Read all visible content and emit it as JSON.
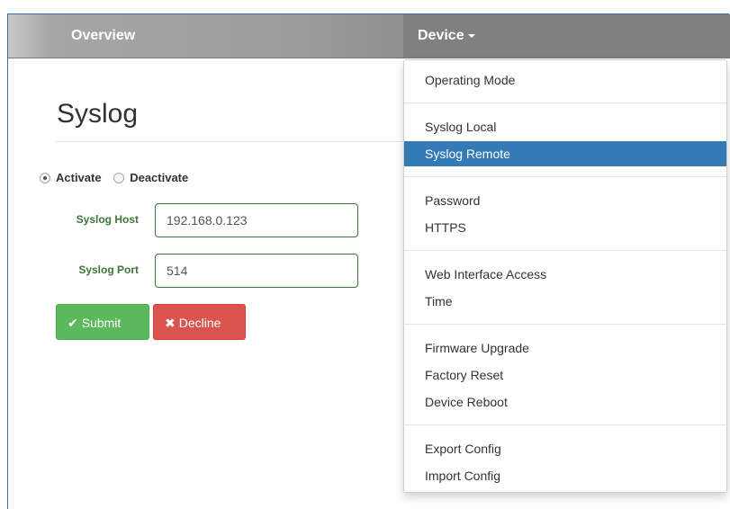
{
  "navbar": {
    "overview_label": "Overview",
    "device_label": "Device"
  },
  "page": {
    "title": "Syslog"
  },
  "status": {
    "activate_label": "Activate",
    "deactivate_label": "Deactivate",
    "selected": "Activate"
  },
  "form": {
    "host_label": "Syslog Host",
    "host_value": "192.168.0.123",
    "port_label": "Syslog Port",
    "port_value": "514"
  },
  "buttons": {
    "submit_label": "Submit",
    "decline_label": "Decline"
  },
  "device_menu": {
    "items": [
      "Operating Mode",
      "Syslog Local",
      "Syslog Remote",
      "Password",
      "HTTPS",
      "Web Interface Access",
      "Time",
      "Firmware Upgrade",
      "Factory Reset",
      "Device Reboot",
      "Export Config",
      "Import Config"
    ],
    "active_item": "Syslog Remote"
  },
  "colors": {
    "active_menu": "#337ab7",
    "submit": "#5cb85c",
    "decline": "#d9534f",
    "field_border": "#3c763d"
  }
}
